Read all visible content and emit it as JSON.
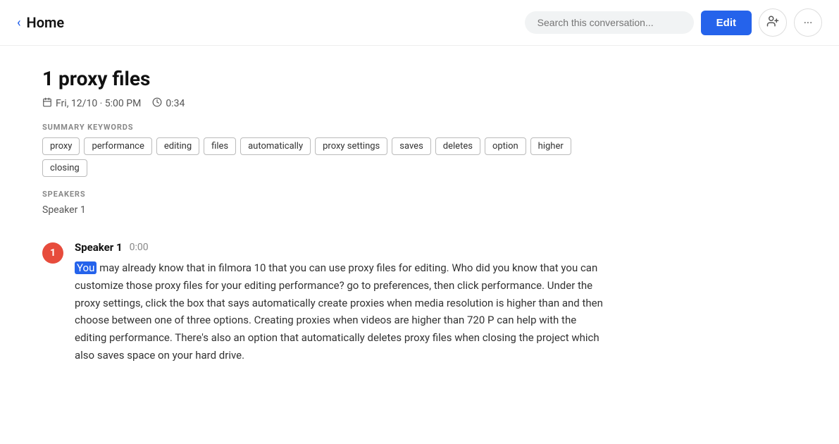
{
  "header": {
    "back_label": "‹",
    "home_label": "Home",
    "search_placeholder": "Search this conversation...",
    "edit_label": "Edit",
    "add_person_icon": "👤",
    "more_icon": "···"
  },
  "conversation": {
    "title": "1 proxy files",
    "date": "Fri, 12/10 · 5:00 PM",
    "duration": "0:34",
    "summary_keywords_label": "SUMMARY KEYWORDS",
    "keywords": [
      "proxy",
      "performance",
      "editing",
      "files",
      "automatically",
      "proxy settings",
      "saves",
      "deletes",
      "option",
      "higher",
      "closing"
    ],
    "speakers_label": "SPEAKERS",
    "speakers": [
      "Speaker 1"
    ]
  },
  "transcript": {
    "entries": [
      {
        "badge": "1",
        "speaker": "Speaker 1",
        "timestamp": "0:00",
        "highlighted_word": "You",
        "text": " may already know that in filmora 10 that you can use proxy files for editing. Who did you know that you can customize those proxy files for your editing performance? go to preferences, then click performance. Under the proxy settings, click the box that says automatically create proxies when media resolution is higher than and then choose between one of three options. Creating proxies when videos are higher than 720 P can help with the editing performance. There's also an option that automatically deletes proxy files when closing the project which also saves space on your hard drive."
      }
    ]
  }
}
